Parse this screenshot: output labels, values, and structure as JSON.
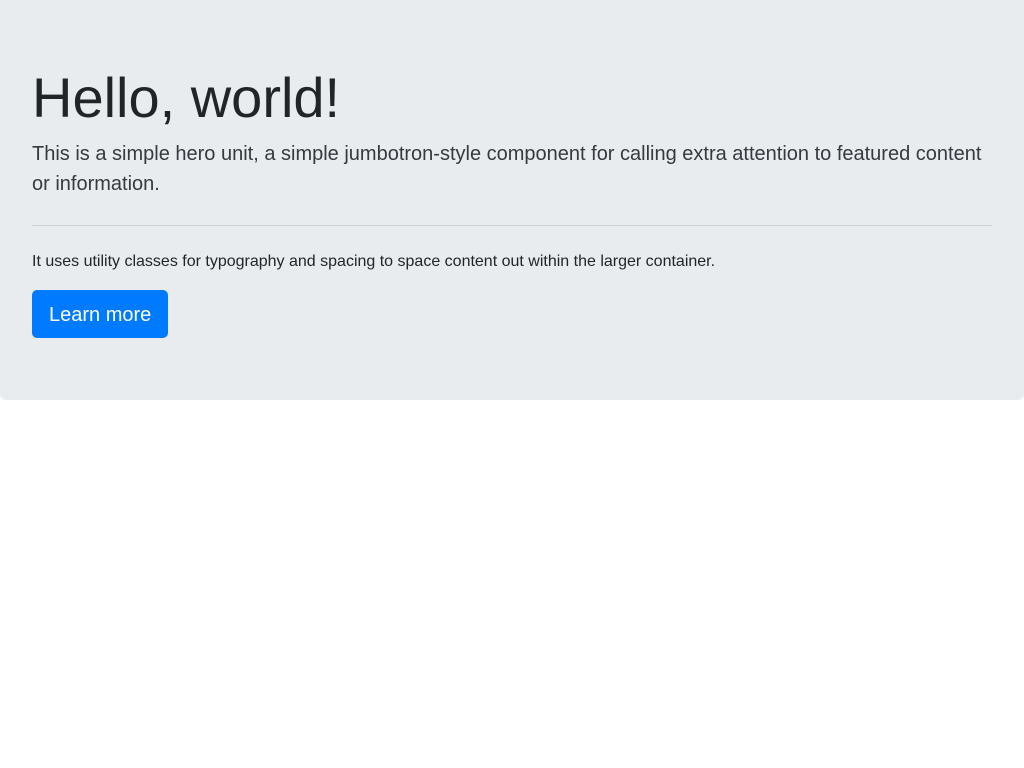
{
  "jumbotron": {
    "title": "Hello, world!",
    "lead": "This is a simple hero unit, a simple jumbotron-style component for calling extra attention to featured content or information.",
    "text": "It uses utility classes for typography and spacing to space content out within the larger container.",
    "button_label": "Learn more"
  },
  "colors": {
    "background": "#e9ecef",
    "primary": "#007bff",
    "text": "#212529"
  }
}
